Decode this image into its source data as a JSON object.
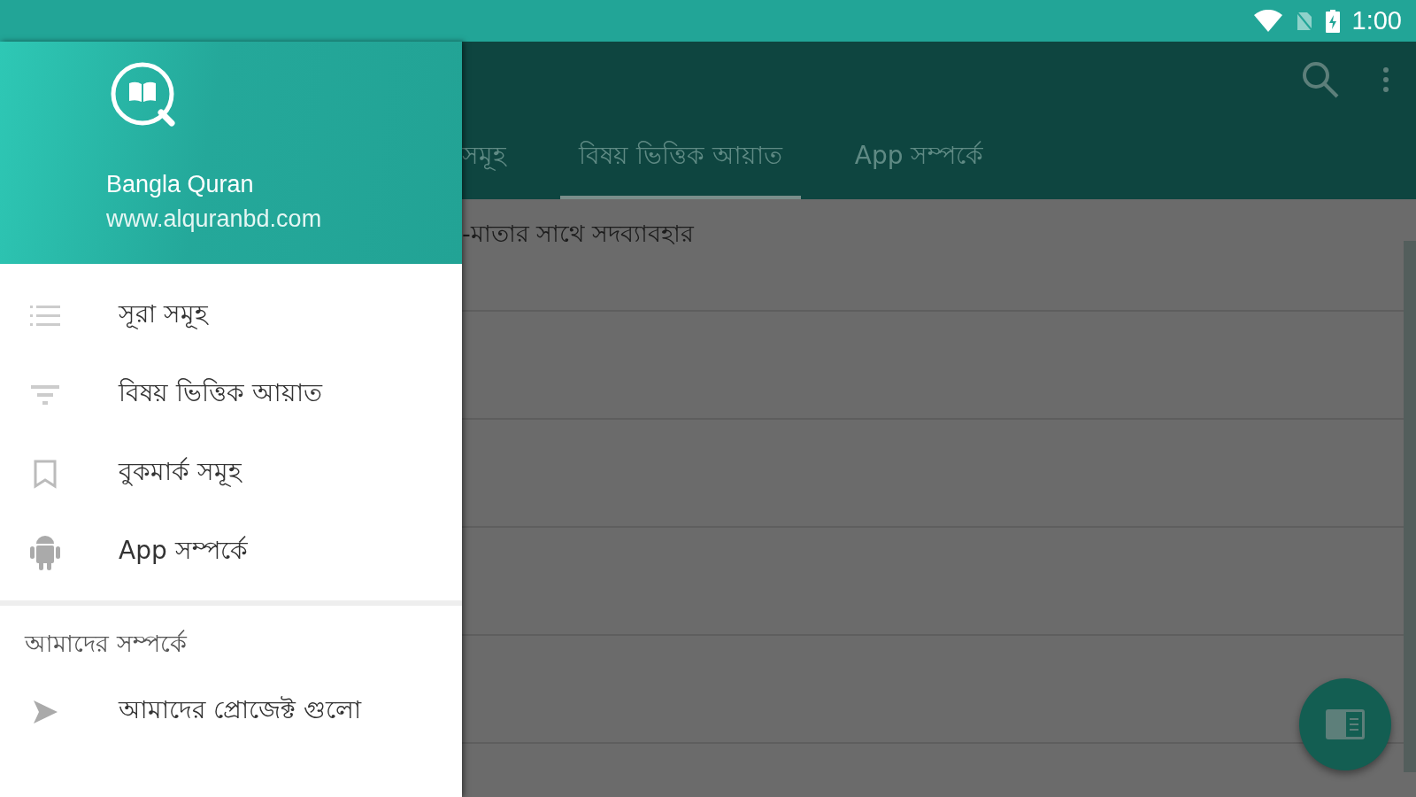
{
  "status_bar": {
    "time": "1:00"
  },
  "drawer": {
    "header": {
      "title": "Bangla Quran",
      "subtitle": "www.alquranbd.com"
    },
    "items": [
      {
        "label": "সূরা সমূহ"
      },
      {
        "label": "বিষয় ভিত্তিক আয়াত"
      },
      {
        "label": "বুকমার্ক সমূহ"
      },
      {
        "label": "App সম্পর্কে"
      }
    ],
    "section": {
      "title": "আমাদের সম্পর্কে",
      "items": [
        {
          "label": "আমাদের প্রোজেক্ট গুলো"
        }
      ]
    }
  },
  "tabs": [
    {
      "label": "সমূহ",
      "selected": false
    },
    {
      "label": "বিষয় ভিত্তিক আয়াত",
      "selected": true
    },
    {
      "label": "App সম্পর্কে",
      "selected": false
    }
  ],
  "rows": [
    {
      "text": "-মাতার সাথে সদব্যাবহার"
    }
  ]
}
